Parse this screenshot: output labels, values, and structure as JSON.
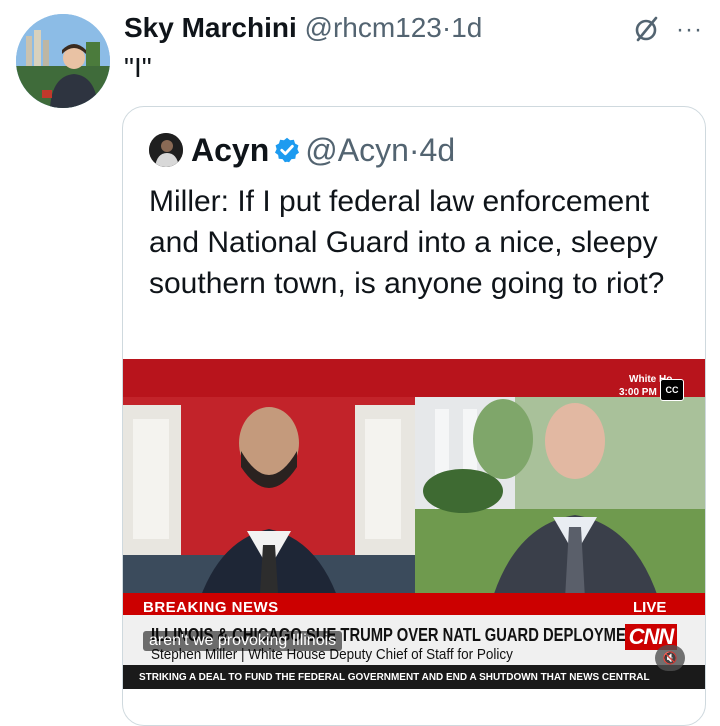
{
  "tweet": {
    "display_name": "Sky Marchini",
    "handle": "@rhcm123",
    "separator": "·",
    "time": "1d",
    "text": "\"I\"",
    "icons": {
      "grok": "grok-icon",
      "more": "more-icon"
    }
  },
  "quoted": {
    "display_name": "Acyn",
    "handle": "@Acyn",
    "separator": "·",
    "time": "4d",
    "text": "Miller: If I put federal law enforcement and National Guard into a nice, sleepy southern town, is anyone going to riot?",
    "verified": true,
    "verified_color": "#1d9bf0"
  },
  "video": {
    "bug_line1": "White Ho",
    "bug_line2": "3:00 PM ET",
    "cc_label": "CC",
    "breaking_label": "BREAKING NEWS",
    "live_label": "LIVE",
    "headline": "ILLINOIS & CHICAGO SUE TRUMP OVER NATL GUARD DEPLOYMENT",
    "lower_third": "Stephen Miller | White House Deputy Chief of Staff for Policy",
    "subtitle": "aren't we provoking Illinois",
    "network": "CNN",
    "ticker": "STRIKING A DEAL TO FUND THE FEDERAL GOVERNMENT AND END A SHUTDOWN THAT NEWS CENTRAL",
    "mute_icon": "muted-speaker-icon",
    "brand_color": "#cc0000"
  }
}
